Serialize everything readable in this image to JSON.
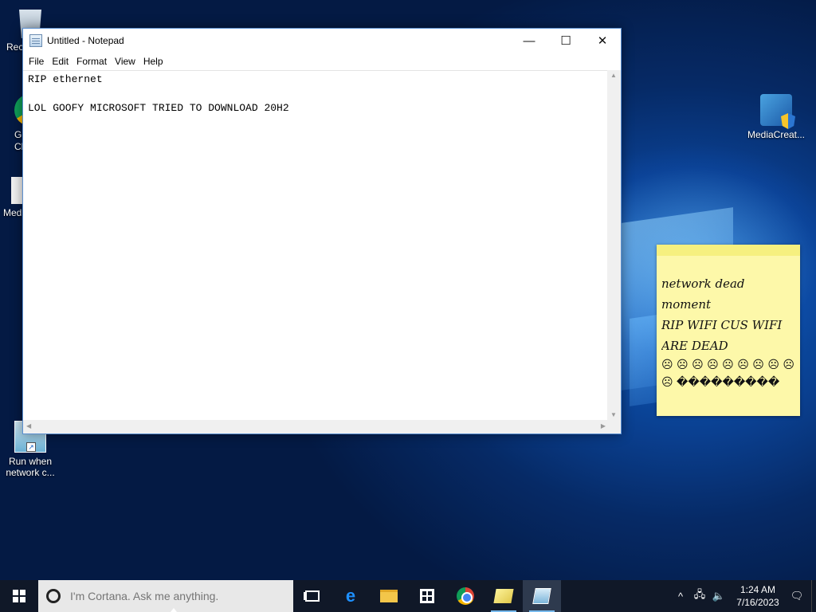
{
  "desktop": {
    "icons": [
      {
        "label": "Rec"
      },
      {
        "label": "G\nCl"
      },
      {
        "label": "Med"
      },
      {
        "label": "Run when network c..."
      },
      {
        "label": "MediaCreat..."
      }
    ]
  },
  "notepad": {
    "title": "Untitled - Notepad",
    "icon": "notepad-icon",
    "controls": {
      "minimize": "—",
      "maximize": "☐",
      "close": "✕"
    },
    "menu": [
      "File",
      "Edit",
      "Format",
      "View",
      "Help"
    ],
    "content": "RIP ethernet\n\nLOL GOOFY MICROSOFT TRIED TO DOWNLOAD 20H2"
  },
  "sticky_note": {
    "lines": [
      "network dead",
      "moment",
      "RIP WIFI CUS WIFI",
      "ARE DEAD"
    ],
    "emoji_text": "☹ ☹ ☹ ☹ ☹ ☹ ☹ ☹ ☹ ☹ ���������"
  },
  "taskbar": {
    "cortana_placeholder": "I'm Cortana. Ask me anything.",
    "apps": [
      "task-view-icon",
      "edge-icon",
      "file-explorer-icon",
      "store-icon",
      "chrome-icon",
      "sticky-notes-icon",
      "notepad-icon"
    ],
    "tray": {
      "chevron": "^",
      "network": "🖧",
      "volume": "🔈",
      "notifications": "🗨"
    },
    "clock": {
      "time": "1:24 AM",
      "date": "7/16/2023"
    }
  },
  "colors": {
    "accent": "#76b9ed",
    "taskbar": "#101828",
    "sticky": "#fdf8a9"
  }
}
